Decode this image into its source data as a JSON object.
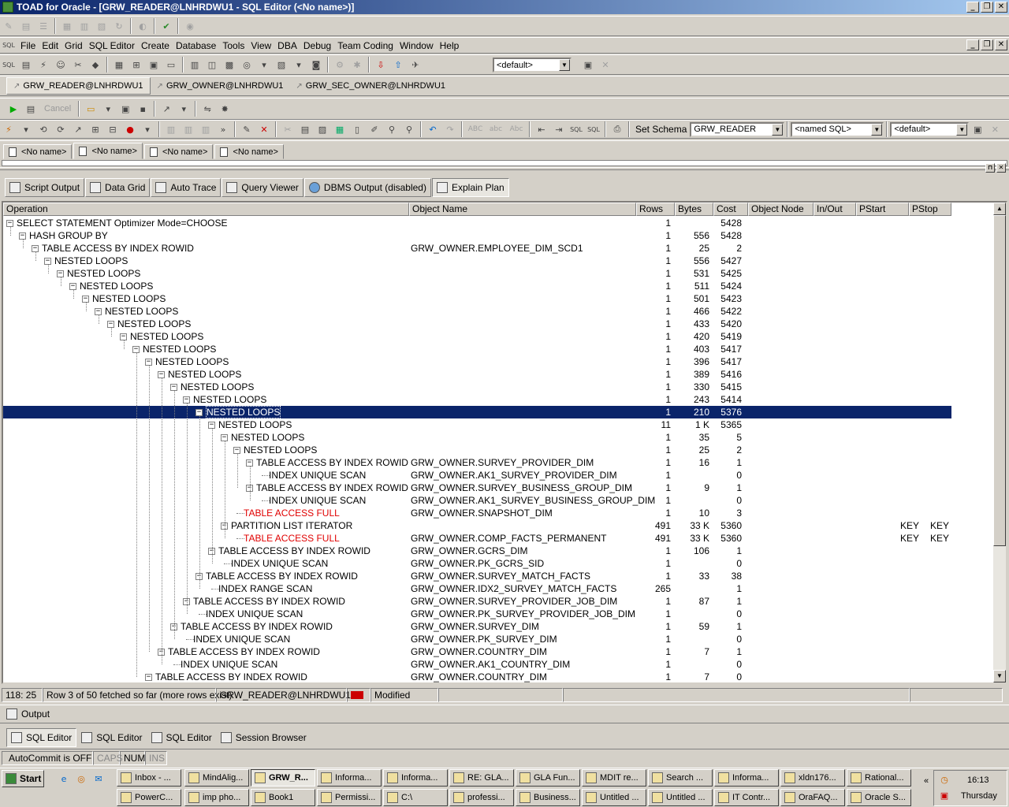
{
  "window": {
    "title": "TOAD for Oracle - [GRW_READER@LNHRDWU1 - SQL Editor (<No name>)]"
  },
  "menu": [
    "File",
    "Edit",
    "Grid",
    "SQL Editor",
    "Create",
    "Database",
    "Tools",
    "View",
    "DBA",
    "Debug",
    "Team Coding",
    "Window",
    "Help"
  ],
  "toolbar": {
    "default_combo": "<default>"
  },
  "connections": [
    "GRW_READER@LNHRDWU1",
    "GRW_OWNER@LNHRDWU1",
    "GRW_SEC_OWNER@LNHRDWU1"
  ],
  "editor_toolbar": {
    "cancel_label": "Cancel"
  },
  "schema_bar": {
    "set_schema_label": "Set Schema",
    "schema_value": "GRW_READER",
    "named_sql": "<named SQL>",
    "default_value": "<default>"
  },
  "doc_tabs": [
    "<No name>",
    "<No name>",
    "<No name>",
    "<No name>"
  ],
  "output_tabs": [
    "Script Output",
    "Data Grid",
    "Auto Trace",
    "Query Viewer",
    "DBMS Output (disabled)",
    "Explain Plan"
  ],
  "plan": {
    "columns": [
      "Operation",
      "Object Name",
      "Rows",
      "Bytes",
      "Cost",
      "Object Node",
      "In/Out",
      "PStart",
      "PStop"
    ],
    "rows": [
      {
        "level": 0,
        "op": "SELECT STATEMENT Optimizer Mode=CHOOSE",
        "obj": "",
        "rows": "1",
        "bytes": "",
        "cost": "5428",
        "pstart": "",
        "pstop": "",
        "exp": true
      },
      {
        "level": 1,
        "op": "HASH GROUP BY",
        "obj": "",
        "rows": "1",
        "bytes": "556",
        "cost": "5428",
        "pstart": "",
        "pstop": "",
        "exp": true
      },
      {
        "level": 2,
        "op": "TABLE ACCESS BY INDEX ROWID",
        "obj": "GRW_OWNER.EMPLOYEE_DIM_SCD1",
        "rows": "1",
        "bytes": "25",
        "cost": "2",
        "pstart": "",
        "pstop": "",
        "exp": true
      },
      {
        "level": 3,
        "op": "NESTED LOOPS",
        "obj": "",
        "rows": "1",
        "bytes": "556",
        "cost": "5427",
        "pstart": "",
        "pstop": "",
        "exp": true
      },
      {
        "level": 4,
        "op": "NESTED LOOPS",
        "obj": "",
        "rows": "1",
        "bytes": "531",
        "cost": "5425",
        "pstart": "",
        "pstop": "",
        "exp": true
      },
      {
        "level": 5,
        "op": "NESTED LOOPS",
        "obj": "",
        "rows": "1",
        "bytes": "511",
        "cost": "5424",
        "pstart": "",
        "pstop": "",
        "exp": true
      },
      {
        "level": 6,
        "op": "NESTED LOOPS",
        "obj": "",
        "rows": "1",
        "bytes": "501",
        "cost": "5423",
        "pstart": "",
        "pstop": "",
        "exp": true
      },
      {
        "level": 7,
        "op": "NESTED LOOPS",
        "obj": "",
        "rows": "1",
        "bytes": "466",
        "cost": "5422",
        "pstart": "",
        "pstop": "",
        "exp": true
      },
      {
        "level": 8,
        "op": "NESTED LOOPS",
        "obj": "",
        "rows": "1",
        "bytes": "433",
        "cost": "5420",
        "pstart": "",
        "pstop": "",
        "exp": true
      },
      {
        "level": 9,
        "op": "NESTED LOOPS",
        "obj": "",
        "rows": "1",
        "bytes": "420",
        "cost": "5419",
        "pstart": "",
        "pstop": "",
        "exp": true
      },
      {
        "level": 10,
        "op": "NESTED LOOPS",
        "obj": "",
        "rows": "1",
        "bytes": "403",
        "cost": "5417",
        "pstart": "",
        "pstop": "",
        "exp": true
      },
      {
        "level": 11,
        "op": "NESTED LOOPS",
        "obj": "",
        "rows": "1",
        "bytes": "396",
        "cost": "5417",
        "pstart": "",
        "pstop": "",
        "exp": true
      },
      {
        "level": 12,
        "op": "NESTED LOOPS",
        "obj": "",
        "rows": "1",
        "bytes": "389",
        "cost": "5416",
        "pstart": "",
        "pstop": "",
        "exp": true
      },
      {
        "level": 13,
        "op": "NESTED LOOPS",
        "obj": "",
        "rows": "1",
        "bytes": "330",
        "cost": "5415",
        "pstart": "",
        "pstop": "",
        "exp": true
      },
      {
        "level": 14,
        "op": "NESTED LOOPS",
        "obj": "",
        "rows": "1",
        "bytes": "243",
        "cost": "5414",
        "pstart": "",
        "pstop": "",
        "exp": true
      },
      {
        "level": 15,
        "op": "NESTED LOOPS",
        "obj": "",
        "rows": "1",
        "bytes": "210",
        "cost": "5376",
        "pstart": "",
        "pstop": "",
        "exp": true,
        "selected": true
      },
      {
        "level": 16,
        "op": "NESTED LOOPS",
        "obj": "",
        "rows": "11",
        "bytes": "1 K",
        "cost": "5365",
        "pstart": "",
        "pstop": "",
        "exp": true
      },
      {
        "level": 17,
        "op": "NESTED LOOPS",
        "obj": "",
        "rows": "1",
        "bytes": "35",
        "cost": "5",
        "pstart": "",
        "pstop": "",
        "exp": true
      },
      {
        "level": 18,
        "op": "NESTED LOOPS",
        "obj": "",
        "rows": "1",
        "bytes": "25",
        "cost": "2",
        "pstart": "",
        "pstop": "",
        "exp": true
      },
      {
        "level": 19,
        "op": "TABLE ACCESS BY INDEX ROWID",
        "obj": "GRW_OWNER.SURVEY_PROVIDER_DIM",
        "rows": "1",
        "bytes": "16",
        "cost": "1",
        "pstart": "",
        "pstop": "",
        "exp": true
      },
      {
        "level": 20,
        "op": "INDEX UNIQUE SCAN",
        "obj": "GRW_OWNER.AK1_SURVEY_PROVIDER_DIM",
        "rows": "1",
        "bytes": "",
        "cost": "0",
        "pstart": "",
        "pstop": ""
      },
      {
        "level": 19,
        "op": "TABLE ACCESS BY INDEX ROWID",
        "obj": "GRW_OWNER.SURVEY_BUSINESS_GROUP_DIM",
        "rows": "1",
        "bytes": "9",
        "cost": "1",
        "pstart": "",
        "pstop": "",
        "exp": true
      },
      {
        "level": 20,
        "op": "INDEX UNIQUE SCAN",
        "obj": "GRW_OWNER.AK1_SURVEY_BUSINESS_GROUP_DIM",
        "rows": "1",
        "bytes": "",
        "cost": "0",
        "pstart": "",
        "pstop": ""
      },
      {
        "level": 18,
        "op": "TABLE ACCESS FULL",
        "obj": "GRW_OWNER.SNAPSHOT_DIM",
        "rows": "1",
        "bytes": "10",
        "cost": "3",
        "pstart": "",
        "pstop": "",
        "red": true
      },
      {
        "level": 17,
        "op": "PARTITION LIST ITERATOR",
        "obj": "",
        "rows": "491",
        "bytes": "33 K",
        "cost": "5360",
        "pstart": "KEY",
        "pstop": "KEY",
        "exp": true
      },
      {
        "level": 18,
        "op": "TABLE ACCESS FULL",
        "obj": "GRW_OWNER.COMP_FACTS_PERMANENT",
        "rows": "491",
        "bytes": "33 K",
        "cost": "5360",
        "pstart": "KEY",
        "pstop": "KEY",
        "red": true
      },
      {
        "level": 16,
        "op": "TABLE ACCESS BY INDEX ROWID",
        "obj": "GRW_OWNER.GCRS_DIM",
        "rows": "1",
        "bytes": "106",
        "cost": "1",
        "pstart": "",
        "pstop": "",
        "exp": true
      },
      {
        "level": 17,
        "op": "INDEX UNIQUE SCAN",
        "obj": "GRW_OWNER.PK_GCRS_SID",
        "rows": "1",
        "bytes": "",
        "cost": "0",
        "pstart": "",
        "pstop": ""
      },
      {
        "level": 15,
        "op": "TABLE ACCESS BY INDEX ROWID",
        "obj": "GRW_OWNER.SURVEY_MATCH_FACTS",
        "rows": "1",
        "bytes": "33",
        "cost": "38",
        "pstart": "",
        "pstop": "",
        "exp": true
      },
      {
        "level": 16,
        "op": "INDEX RANGE SCAN",
        "obj": "GRW_OWNER.IDX2_SURVEY_MATCH_FACTS",
        "rows": "265",
        "bytes": "",
        "cost": "1",
        "pstart": "",
        "pstop": ""
      },
      {
        "level": 14,
        "op": "TABLE ACCESS BY INDEX ROWID",
        "obj": "GRW_OWNER.SURVEY_PROVIDER_JOB_DIM",
        "rows": "1",
        "bytes": "87",
        "cost": "1",
        "pstart": "",
        "pstop": "",
        "exp": true
      },
      {
        "level": 15,
        "op": "INDEX UNIQUE SCAN",
        "obj": "GRW_OWNER.PK_SURVEY_PROVIDER_JOB_DIM",
        "rows": "1",
        "bytes": "",
        "cost": "0",
        "pstart": "",
        "pstop": ""
      },
      {
        "level": 13,
        "op": "TABLE ACCESS BY INDEX ROWID",
        "obj": "GRW_OWNER.SURVEY_DIM",
        "rows": "1",
        "bytes": "59",
        "cost": "1",
        "pstart": "",
        "pstop": "",
        "exp": true
      },
      {
        "level": 14,
        "op": "INDEX UNIQUE SCAN",
        "obj": "GRW_OWNER.PK_SURVEY_DIM",
        "rows": "1",
        "bytes": "",
        "cost": "0",
        "pstart": "",
        "pstop": ""
      },
      {
        "level": 12,
        "op": "TABLE ACCESS BY INDEX ROWID",
        "obj": "GRW_OWNER.COUNTRY_DIM",
        "rows": "1",
        "bytes": "7",
        "cost": "1",
        "pstart": "",
        "pstop": "",
        "exp": true
      },
      {
        "level": 13,
        "op": "INDEX UNIQUE SCAN",
        "obj": "GRW_OWNER.AK1_COUNTRY_DIM",
        "rows": "1",
        "bytes": "",
        "cost": "0",
        "pstart": "",
        "pstop": ""
      },
      {
        "level": 11,
        "op": "TABLE ACCESS BY INDEX ROWID",
        "obj": "GRW_OWNER.COUNTRY_DIM",
        "rows": "1",
        "bytes": "7",
        "cost": "0",
        "pstart": "",
        "pstop": "",
        "exp": true
      }
    ]
  },
  "status_bar": {
    "position": "118: 25",
    "fetch_status": "Row 3 of 50 fetched so far (more rows exist)",
    "connection": "GRW_READER@LNHRDWU1",
    "modified": "Modified"
  },
  "output_panel": {
    "label": "Output"
  },
  "window_tabs": [
    "SQL Editor",
    "SQL Editor",
    "SQL Editor",
    "Session Browser"
  ],
  "bottom_status": {
    "autocommit": "AutoCommit is OFF",
    "caps": "CAPS",
    "num": "NUM",
    "ins": "INS"
  },
  "taskbar": {
    "start": "Start",
    "row1": [
      "Inbox - ...",
      "MindAlig...",
      "GRW_R...",
      "Informa...",
      "Informa...",
      "RE: GLA...",
      "GLA Fun...",
      "MDIT re...",
      "Search ...",
      "Informa...",
      "xldn176...",
      "Rational..."
    ],
    "row2": [
      "PowerC...",
      "imp pho...",
      "Book1",
      "Permissi...",
      "C:\\",
      "professi...",
      "Business...",
      "Untitled ...",
      "Untitled ...",
      "IT Contr...",
      "OraFAQ...",
      "Oracle S..."
    ],
    "time": "16:13",
    "day": "Thursday"
  }
}
